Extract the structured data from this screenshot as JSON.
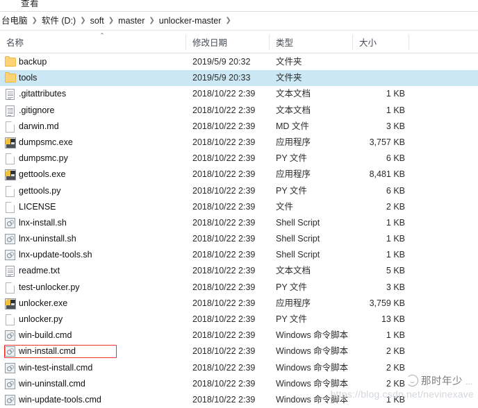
{
  "ribbon": {
    "tab_view_label": "查看"
  },
  "address_bar": {
    "crumbs": [
      "台电脑",
      "软件 (D:)",
      "soft",
      "master",
      "unlocker-master"
    ],
    "separator": "❯"
  },
  "columns": {
    "name": "名称",
    "date_modified": "修改日期",
    "type": "类型",
    "size": "大小",
    "sort_indicator": "⌃"
  },
  "files": [
    {
      "name": "backup",
      "icon": "folder-icon",
      "date": "2019/5/9 20:32",
      "type": "文件夹",
      "size": "",
      "selected": false
    },
    {
      "name": "tools",
      "icon": "folder-icon",
      "date": "2019/5/9 20:33",
      "type": "文件夹",
      "size": "",
      "selected": true
    },
    {
      "name": ".gitattributes",
      "icon": "text-icon",
      "date": "2018/10/22 2:39",
      "type": "文本文档",
      "size": "1 KB",
      "selected": false
    },
    {
      "name": ".gitignore",
      "icon": "text-icon",
      "date": "2018/10/22 2:39",
      "type": "文本文档",
      "size": "1 KB",
      "selected": false
    },
    {
      "name": "darwin.md",
      "icon": "file-icon",
      "date": "2018/10/22 2:39",
      "type": "MD 文件",
      "size": "3 KB",
      "selected": false
    },
    {
      "name": "dumpsmc.exe",
      "icon": "exe-icon",
      "date": "2018/10/22 2:39",
      "type": "应用程序",
      "size": "3,757 KB",
      "selected": false
    },
    {
      "name": "dumpsmc.py",
      "icon": "file-icon",
      "date": "2018/10/22 2:39",
      "type": "PY 文件",
      "size": "6 KB",
      "selected": false
    },
    {
      "name": "gettools.exe",
      "icon": "exe-icon",
      "date": "2018/10/22 2:39",
      "type": "应用程序",
      "size": "8,481 KB",
      "selected": false
    },
    {
      "name": "gettools.py",
      "icon": "file-icon",
      "date": "2018/10/22 2:39",
      "type": "PY 文件",
      "size": "6 KB",
      "selected": false
    },
    {
      "name": "LICENSE",
      "icon": "file-icon",
      "date": "2018/10/22 2:39",
      "type": "文件",
      "size": "2 KB",
      "selected": false
    },
    {
      "name": "lnx-install.sh",
      "icon": "script-icon",
      "date": "2018/10/22 2:39",
      "type": "Shell Script",
      "size": "1 KB",
      "selected": false
    },
    {
      "name": "lnx-uninstall.sh",
      "icon": "script-icon",
      "date": "2018/10/22 2:39",
      "type": "Shell Script",
      "size": "1 KB",
      "selected": false
    },
    {
      "name": "lnx-update-tools.sh",
      "icon": "script-icon",
      "date": "2018/10/22 2:39",
      "type": "Shell Script",
      "size": "1 KB",
      "selected": false
    },
    {
      "name": "readme.txt",
      "icon": "text-icon",
      "date": "2018/10/22 2:39",
      "type": "文本文档",
      "size": "5 KB",
      "selected": false
    },
    {
      "name": "test-unlocker.py",
      "icon": "file-icon",
      "date": "2018/10/22 2:39",
      "type": "PY 文件",
      "size": "3 KB",
      "selected": false
    },
    {
      "name": "unlocker.exe",
      "icon": "exe-icon",
      "date": "2018/10/22 2:39",
      "type": "应用程序",
      "size": "3,759 KB",
      "selected": false
    },
    {
      "name": "unlocker.py",
      "icon": "file-icon",
      "date": "2018/10/22 2:39",
      "type": "PY 文件",
      "size": "13 KB",
      "selected": false
    },
    {
      "name": "win-build.cmd",
      "icon": "script-icon",
      "date": "2018/10/22 2:39",
      "type": "Windows 命令脚本",
      "size": "1 KB",
      "selected": false
    },
    {
      "name": "win-install.cmd",
      "icon": "script-icon",
      "date": "2018/10/22 2:39",
      "type": "Windows 命令脚本",
      "size": "2 KB",
      "selected": false
    },
    {
      "name": "win-test-install.cmd",
      "icon": "script-icon",
      "date": "2018/10/22 2:39",
      "type": "Windows 命令脚本",
      "size": "2 KB",
      "selected": false
    },
    {
      "name": "win-uninstall.cmd",
      "icon": "script-icon",
      "date": "2018/10/22 2:39",
      "type": "Windows 命令脚本",
      "size": "2 KB",
      "selected": false
    },
    {
      "name": "win-update-tools.cmd",
      "icon": "script-icon",
      "date": "2018/10/22 2:39",
      "type": "Windows 命令脚本",
      "size": "1 KB",
      "selected": false
    }
  ],
  "annotation": {
    "highlighted_file": "win-install.cmd",
    "color": "#e8312a"
  },
  "watermark": {
    "nickname": "那时年少",
    "dots": "…",
    "url": "https://blog.csdn.net/nevinexave"
  }
}
